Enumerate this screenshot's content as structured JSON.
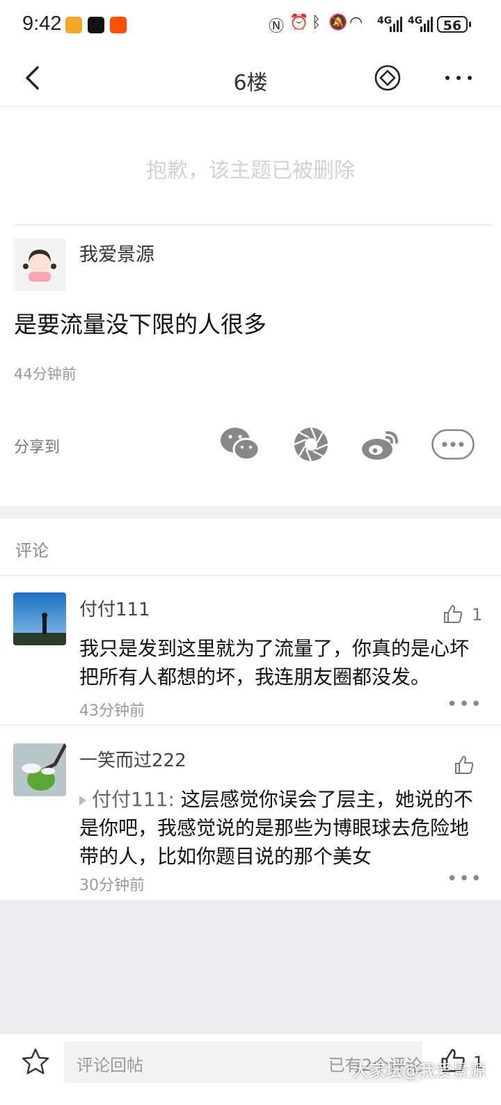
{
  "status_bar": {
    "time": "9:42",
    "network_1": "4G",
    "network_2": "4G",
    "battery": "56"
  },
  "nav": {
    "title": "6楼"
  },
  "post": {
    "deleted_notice": "抱歉，该主题已被删除",
    "author": "我爱景源",
    "content": "是要流量没下限的人很多",
    "time": "44分钟前",
    "share_label": "分享到"
  },
  "comments_header": "评论",
  "comments": [
    {
      "author": "付付111",
      "like_count": "1",
      "text": "我只是发到这里就为了流量了，你真的是心坏把所有人都想的坏，我连朋友圈都没发。",
      "time": "43分钟前"
    },
    {
      "author": "一笑而过222",
      "quote_prefix": "付付111:",
      "text": "这层感觉你误会了层主，她说的不是你吧，我感觉说的是那些为博眼球去危险地带的人，比如你题目说的那个美女",
      "time": "30分钟前"
    }
  ],
  "bottom": {
    "input_placeholder": "评论回帖",
    "comment_count": "已有2个评论",
    "like_count": "1",
    "watermark": "大家坛@我爱景源"
  }
}
